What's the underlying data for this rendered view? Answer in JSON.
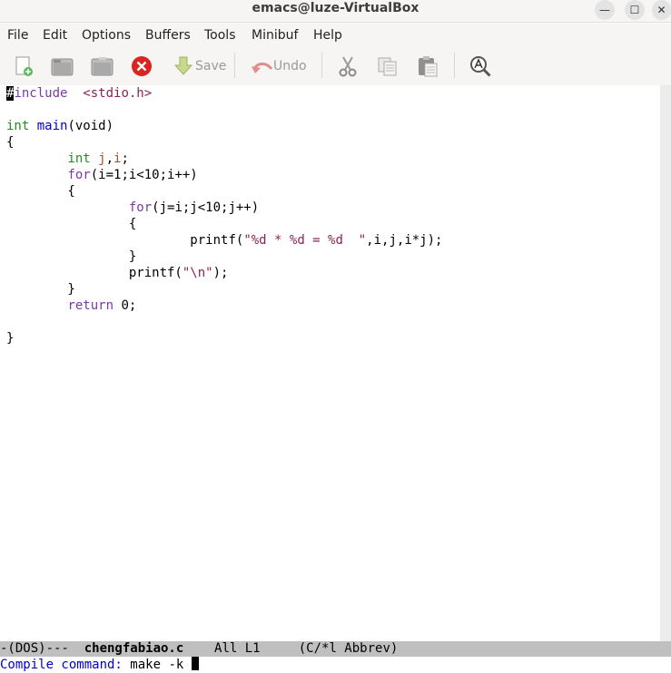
{
  "window": {
    "title": "emacs@luze-VirtualBox",
    "controls": {
      "minimize": "—",
      "maximize": "☐",
      "close": "✕"
    }
  },
  "menu": [
    "File",
    "Edit",
    "Options",
    "Buffers",
    "Tools",
    "Minibuf",
    "Help"
  ],
  "toolbar": {
    "save_label": "Save",
    "undo_label": "Undo",
    "icons": [
      "new-file-icon",
      "open-file-icon",
      "dired-icon",
      "close-buffer-icon",
      "save-icon",
      "undo-icon",
      "cut-icon",
      "copy-icon",
      "paste-icon",
      "search-icon"
    ]
  },
  "code": {
    "l1": {
      "hash": "#",
      "rest": "include  ",
      "hdr": "<stdio.h>"
    },
    "l3": {
      "type": "int",
      "sp": " ",
      "fn": "main",
      "rest": "(void)"
    },
    "l4": "{",
    "l5": {
      "indent": "        ",
      "type": "int",
      "sp": " ",
      "v1": "j",
      "comma": ",",
      "v2": "i",
      "semi": ";"
    },
    "l6": {
      "indent": "        ",
      "kw": "for",
      "rest": "(i=1;i<10;i++)"
    },
    "l7": "        {",
    "l8": {
      "indent": "                ",
      "kw": "for",
      "rest": "(j=i;j<10;j++)"
    },
    "l9": "                {",
    "l10": {
      "indent": "                        ",
      "pre": "printf(",
      "str": "\"%d * %d = %d  \"",
      "post": ",i,j,i*j);"
    },
    "l11": "                }",
    "l12": {
      "indent": "                ",
      "pre": "printf(",
      "str": "\"\\n\"",
      "post": ");"
    },
    "l13": "        }",
    "l14": {
      "indent": "        ",
      "kw": "return",
      "rest": " 0;"
    },
    "l16": "}"
  },
  "modeline": {
    "prefix": "-(DOS)---  ",
    "buffer": "chengfabiao.c",
    "position": "    All L1     ",
    "modes": "(C/*l Abbrev)"
  },
  "minibuffer": {
    "prompt": "Compile command: ",
    "value": "make -k "
  }
}
